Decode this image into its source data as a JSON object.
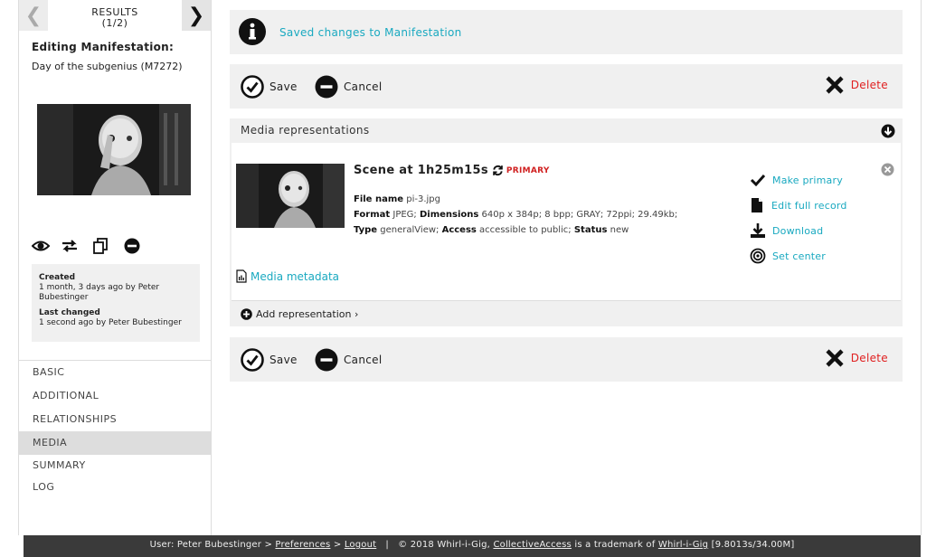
{
  "sidebar": {
    "results_label": "RESULTS",
    "results_count": "(1/2)",
    "editing_title": "Editing Manifestation:",
    "editing_name": "Day of the subgenius (M7272)",
    "created_label": "Created",
    "created_value": "1 month, 3 days ago by Peter Bubestinger",
    "changed_label": "Last changed",
    "changed_value": "1 second ago by Peter Bubestinger",
    "nav": [
      {
        "label": "BASIC"
      },
      {
        "label": "ADDITIONAL"
      },
      {
        "label": "RELATIONSHIPS"
      },
      {
        "label": "MEDIA",
        "active": true
      },
      {
        "label": "SUMMARY"
      },
      {
        "label": "LOG"
      }
    ]
  },
  "notice": {
    "text": "Saved changes to Manifestation",
    "icon": "info-icon"
  },
  "actions": {
    "save": "Save",
    "cancel": "Cancel",
    "delete": "Delete"
  },
  "media": {
    "header": "Media representations",
    "rep_title": "Scene at 1h25m15s",
    "primary_badge": "PRIMARY",
    "file_name_label": "File name",
    "file_name": "pi-3.jpg",
    "format_label": "Format",
    "format": "JPEG;",
    "dimensions_label": "Dimensions",
    "dimensions": "640p x 384p; 8 bpp; GRAY; 72ppi; 29.49kb;",
    "type_label": "Type",
    "type": "generalView;",
    "access_label": "Access",
    "access": "accessible to public;",
    "status_label": "Status",
    "status": "new",
    "metadata_link": "Media metadata",
    "make_primary": "Make primary",
    "edit_full_record": "Edit full record",
    "download": "Download",
    "set_center": "Set center",
    "add_representation": "Add representation ›"
  },
  "footer": {
    "user_prefix": "User: Peter Bubestinger >",
    "preferences": "Preferences",
    "sep1": ">",
    "logout": "Logout",
    "sep2": "|",
    "copyright": "© 2018 Whirl-i-Gig,",
    "collectiveaccess": "CollectiveAccess",
    "trademark_text": "is a trademark of",
    "whirligig": "Whirl-i-Gig",
    "stats": "[9.8013s/34.00M]"
  },
  "colors": {
    "accent": "#19a9c0",
    "danger": "#e02020",
    "panel_bg": "#f0f0f0",
    "footer_bg": "#3a3a3a"
  }
}
